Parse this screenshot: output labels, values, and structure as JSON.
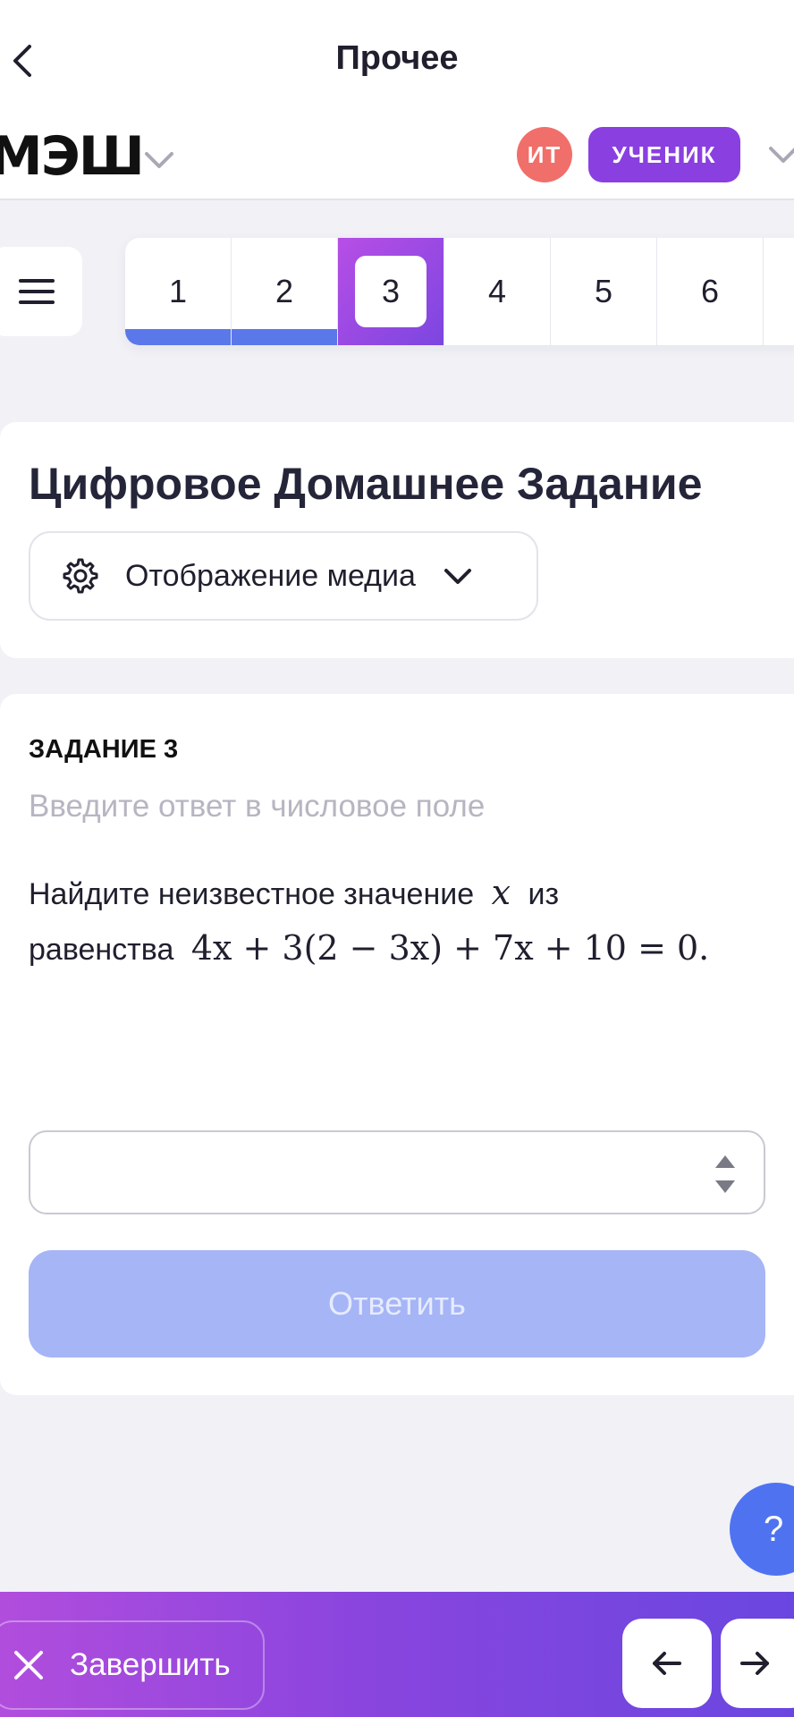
{
  "topbar": {
    "title": "Прочее"
  },
  "brand": {
    "logo": "МЭШ",
    "avatar_initials": "ИТ",
    "role": "УЧЕНИК"
  },
  "pager": {
    "items": [
      {
        "label": "1",
        "state": "done"
      },
      {
        "label": "2",
        "state": "done"
      },
      {
        "label": "3",
        "state": "active"
      },
      {
        "label": "4",
        "state": "todo"
      },
      {
        "label": "5",
        "state": "todo"
      },
      {
        "label": "6",
        "state": "todo"
      }
    ]
  },
  "header": {
    "title": "Цифровое Домашнее Задание",
    "media_button": "Отображение медиа"
  },
  "task": {
    "label": "ЗАДАНИЕ 3",
    "hint": "Введите ответ в числовое поле",
    "text_part1": "Найдите неизвестное значение",
    "variable": "x",
    "text_part2": "из",
    "text_part3": "равенства",
    "equation": "4x + 3(2 − 3x) + 7x + 10 = 0.",
    "answer_value": "",
    "answer_button": "Ответить"
  },
  "help": {
    "label": "?"
  },
  "footer": {
    "finish_label": "Завершить"
  },
  "colors": {
    "accent_purple": "#8a3fe0",
    "progress_blue": "#5a78ea",
    "answer_button": "#a6b5f6",
    "avatar": "#f06f6a"
  },
  "icons": {
    "back": "chevron-left-icon",
    "menu": "hamburger-icon",
    "media": "gear-icon",
    "dropdown": "chevron-down-icon",
    "finish": "close-icon",
    "prev": "arrow-left-icon",
    "next": "arrow-right-icon"
  }
}
